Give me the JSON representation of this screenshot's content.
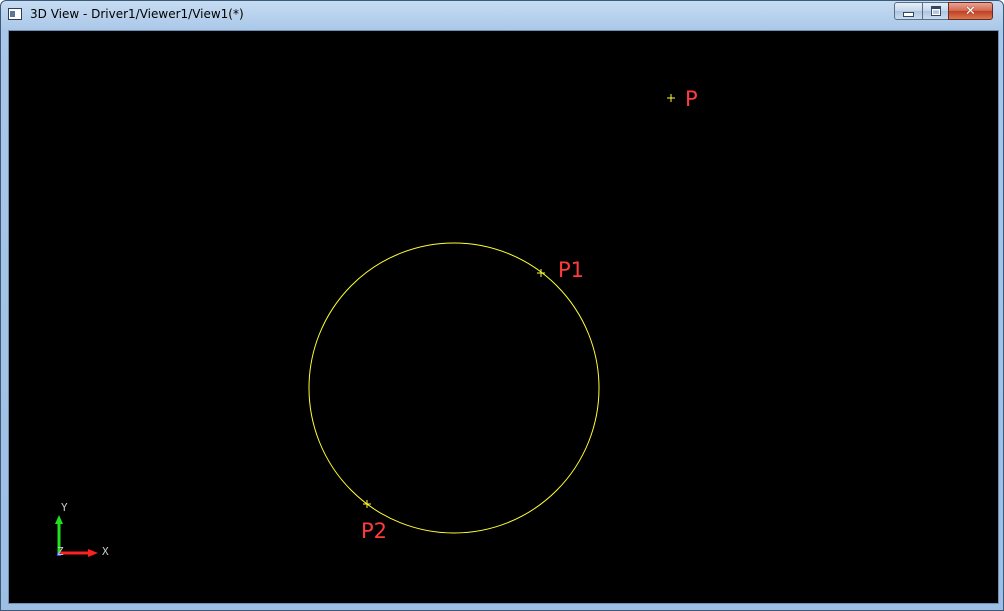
{
  "window": {
    "title": "3D View - Driver1/Viewer1/View1(*)",
    "controls": {
      "minimize_icon": "minimize-icon",
      "maximize_icon": "maximize-icon",
      "close_icon": "close-icon",
      "close_glyph": "✕"
    }
  },
  "viewer": {
    "background": "#000000",
    "geometry_color": "#ffff33",
    "label_color": "#ff3b3b",
    "circle": {
      "type": "circle"
    },
    "points": [
      {
        "label": "P"
      },
      {
        "label": "P1"
      },
      {
        "label": "P2"
      }
    ],
    "triedron": {
      "x_label": "X",
      "y_label": "Y",
      "z_label": "Z",
      "x_color": "#ff2020",
      "y_color": "#20e020",
      "z_color": "#3040ff"
    }
  }
}
